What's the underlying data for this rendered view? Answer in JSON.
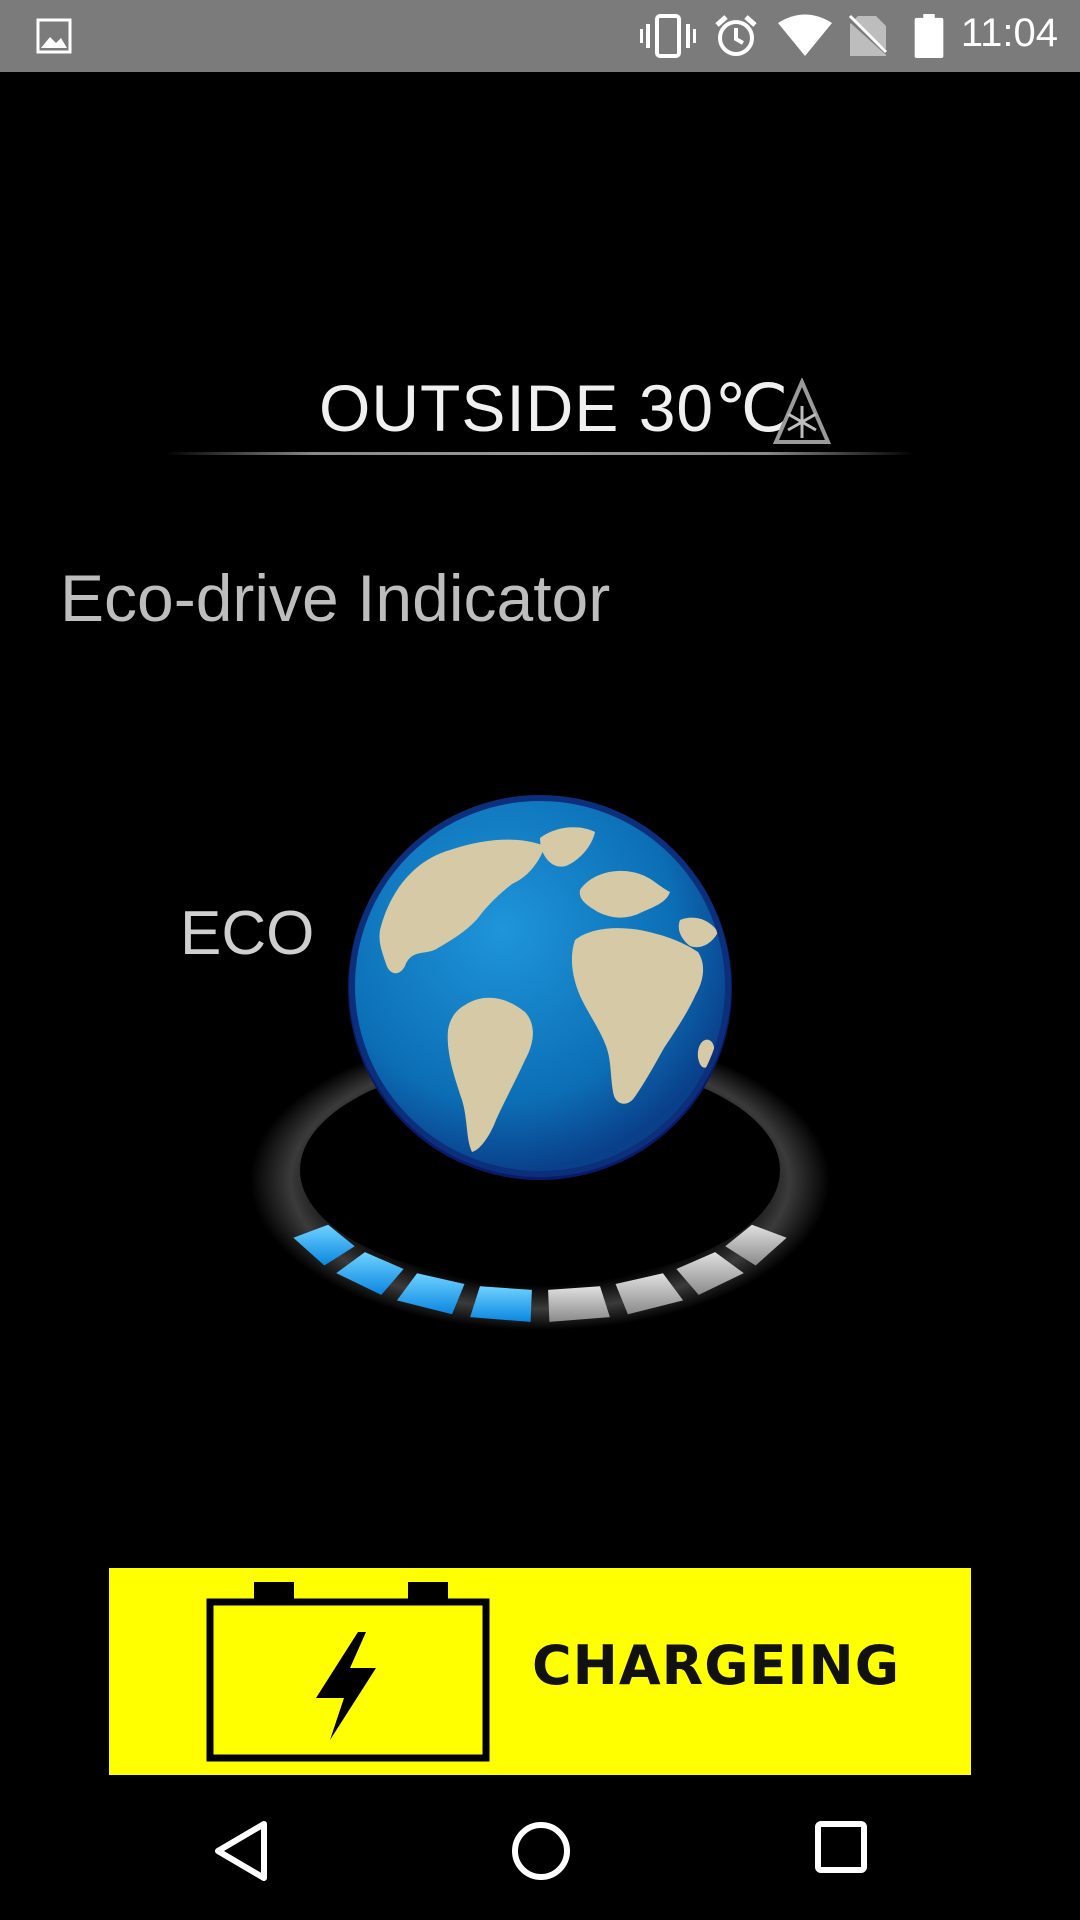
{
  "status_bar": {
    "time": "11:04",
    "icons": [
      "image-icon",
      "vibrate-icon",
      "alarm-icon",
      "wifi-icon",
      "no-sim-icon",
      "battery-icon"
    ]
  },
  "outside": {
    "label": "OUTSIDE 30℃",
    "icon": "warning-snowflake-icon"
  },
  "eco": {
    "title": "Eco-drive Indicator",
    "mode_label": "ECO",
    "level_segments_active": 4,
    "level_segments_total": 8,
    "active_color": "#1fa2ff",
    "inactive_color": "#bdbdbd"
  },
  "charging": {
    "label": "CHARGEING",
    "background": "#ffff00",
    "icon": "battery-charging-icon"
  },
  "nav": {
    "buttons": [
      "back-icon",
      "home-icon",
      "recents-icon"
    ]
  }
}
